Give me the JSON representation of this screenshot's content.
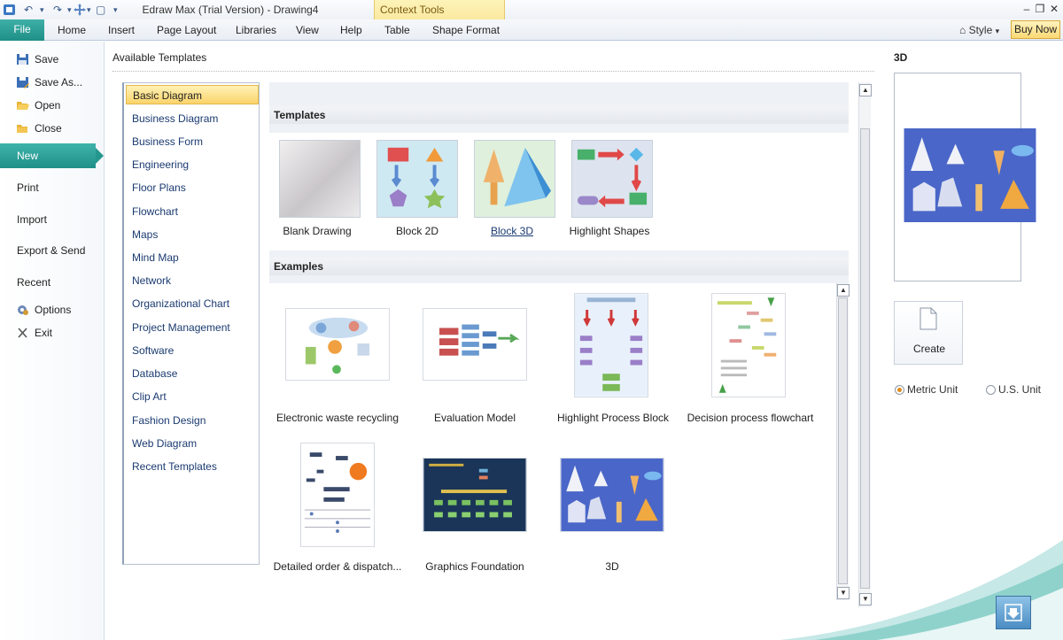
{
  "window": {
    "title": "Edraw Max (Trial Version) - Drawing4",
    "context_tools": "Context Tools",
    "controls": [
      "–",
      "❐",
      "✕"
    ]
  },
  "quick_access": {
    "undo": "↶",
    "redo": "↷",
    "print_preview": "▢",
    "more": "▾"
  },
  "menubar": {
    "file": "File",
    "items": [
      "Home",
      "Insert",
      "Page Layout",
      "Libraries",
      "View",
      "Help",
      "Table",
      "Shape Format"
    ],
    "style": "Style",
    "buy_now": "Buy Now"
  },
  "leftnav": {
    "save": "Save",
    "save_as": "Save As...",
    "open": "Open",
    "close": "Close",
    "new": "New",
    "print": "Print",
    "import": "Import",
    "export_send": "Export & Send",
    "recent": "Recent",
    "options": "Options",
    "exit": "Exit"
  },
  "main": {
    "available_templates": "Available Templates",
    "categories": [
      "Basic Diagram",
      "Business Diagram",
      "Business Form",
      "Engineering",
      "Floor Plans",
      "Flowchart",
      "Maps",
      "Mind Map",
      "Network",
      "Organizational Chart",
      "Project Management",
      "Software",
      "Database",
      "Clip Art",
      "Fashion Design",
      "Web Diagram",
      "Recent Templates"
    ],
    "selected_category": "Basic Diagram",
    "templates_header": "Templates",
    "templates": [
      "Blank Drawing",
      "Block 2D",
      "Block 3D",
      "Highlight Shapes"
    ],
    "examples_header": "Examples",
    "examples": [
      "Electronic waste recycling",
      "Evaluation Model",
      "Highlight Process Block",
      "Decision process flowchart",
      "Detailed order & dispatch...",
      "Graphics Foundation",
      "3D"
    ]
  },
  "preview": {
    "title": "3D",
    "create": "Create",
    "metric_unit": "Metric Unit",
    "us_unit": "U.S. Unit"
  },
  "colors": {
    "accent": "#25978e",
    "selection": "#fbd46b",
    "link": "#1a3a70"
  }
}
